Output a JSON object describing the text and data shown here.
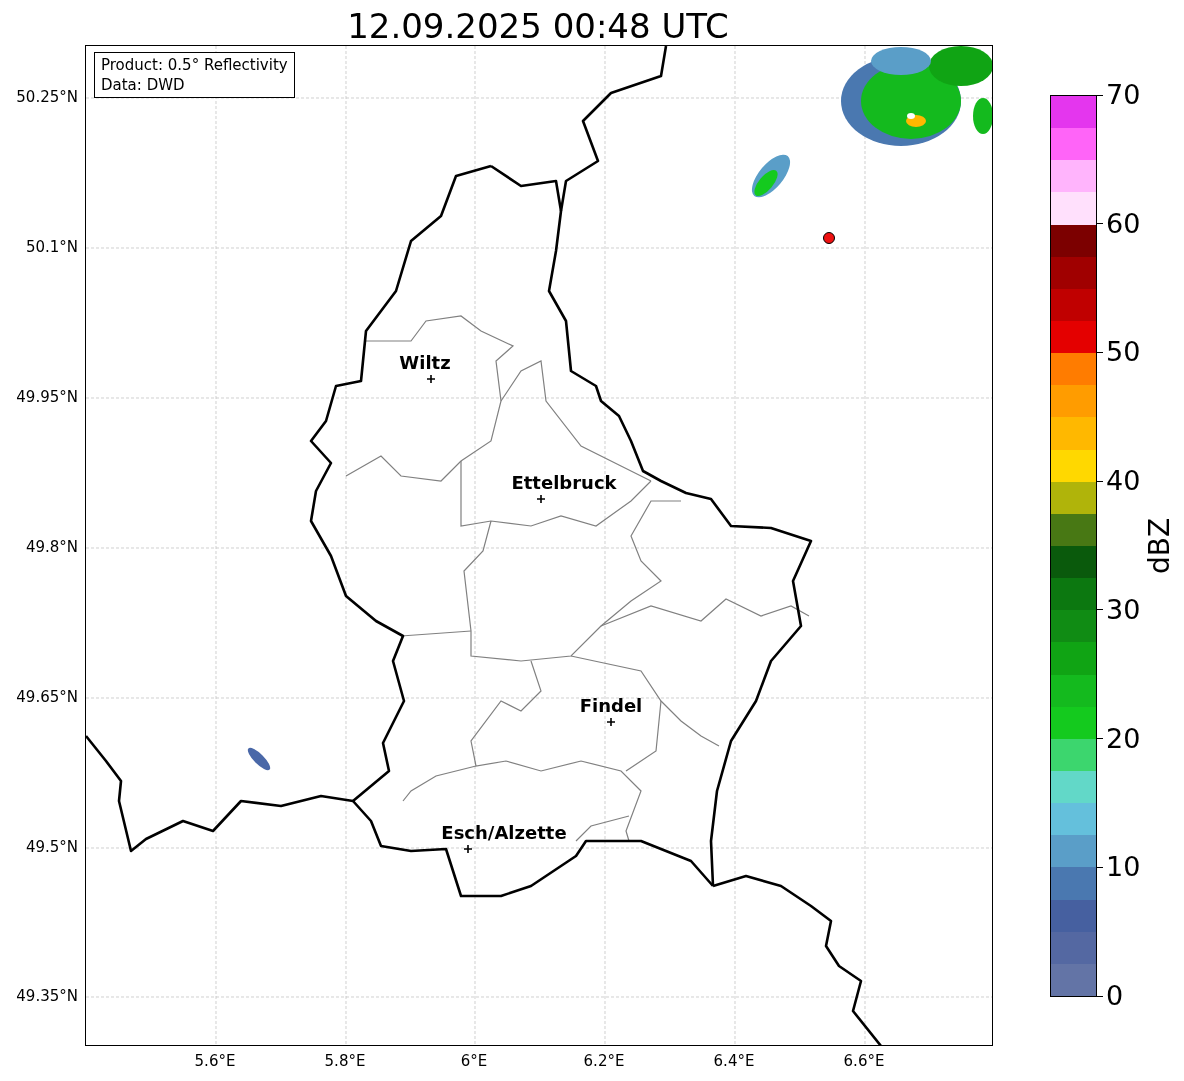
{
  "title": "12.09.2025 00:48 UTC",
  "info_box": {
    "lines": [
      "Product: 0.5° Reflectivity",
      "Data: DWD"
    ]
  },
  "map": {
    "lat_ticks": [
      "50.25°N",
      "50.1°N",
      "49.95°N",
      "49.8°N",
      "49.65°N",
      "49.5°N",
      "49.35°N"
    ],
    "lon_ticks": [
      "5.6°E",
      "5.8°E",
      "6°E",
      "6.2°E",
      "6.4°E",
      "6.6°E"
    ],
    "cities": [
      {
        "name": "Wiltz"
      },
      {
        "name": "Ettelbruck"
      },
      {
        "name": "Findel"
      },
      {
        "name": "Esch/Alzette"
      }
    ]
  },
  "colorbar": {
    "label": "dBZ",
    "ticks": [
      "70",
      "60",
      "50",
      "40",
      "30",
      "20",
      "10",
      "0"
    ],
    "bins": [
      {
        "color": "#e436ee"
      },
      {
        "color": "#ff64f8"
      },
      {
        "color": "#ffb4fc"
      },
      {
        "color": "#ffe0fc"
      },
      {
        "color": "#7c0000"
      },
      {
        "color": "#a00000"
      },
      {
        "color": "#c00000"
      },
      {
        "color": "#e40000"
      },
      {
        "color": "#ff7c00"
      },
      {
        "color": "#ff9c00"
      },
      {
        "color": "#ffb800"
      },
      {
        "color": "#ffd800"
      },
      {
        "color": "#b0b40a"
      },
      {
        "color": "#487814"
      },
      {
        "color": "#0a5a0c"
      },
      {
        "color": "#0c7810"
      },
      {
        "color": "#108c14"
      },
      {
        "color": "#10a414"
      },
      {
        "color": "#14ba1e"
      },
      {
        "color": "#14ca1e"
      },
      {
        "color": "#3cd66e"
      },
      {
        "color": "#62d8c8"
      },
      {
        "color": "#64c0dc"
      },
      {
        "color": "#5a9ec8"
      },
      {
        "color": "#4a78b0"
      },
      {
        "color": "#4660a0"
      },
      {
        "color": "#5468a2"
      },
      {
        "color": "#6374a6"
      }
    ]
  }
}
